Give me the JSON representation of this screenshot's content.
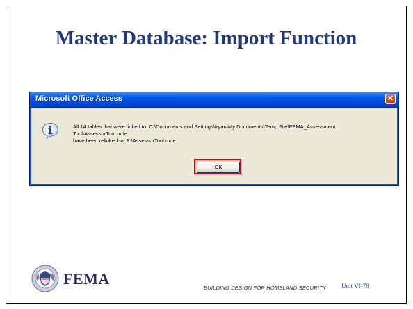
{
  "slide": {
    "title": "Master Database: Import Function",
    "footer": "BUILDING DESIGN FOR HOMELAND SECURITY",
    "unit": "Unit VI-78"
  },
  "logo": {
    "name": "FEMA",
    "seal_icon": "dhs-seal-icon"
  },
  "dialog": {
    "title": "Microsoft Office Access",
    "icon": "info-icon",
    "message_line1": "All 14 tables that were linked to: C:\\Documents and Settings\\tryan\\My Documents\\Temp File\\FEMA_Assessment",
    "message_line2": "Tool\\AssessorTool.mde",
    "message_line3": "have been relinked to: F:\\AssessorTool.mde",
    "ok_label": "OK",
    "close_label": "✕",
    "highlight_color": "#e00000"
  },
  "colors": {
    "title": "#1f3a7a",
    "titlebar": "#0058ee"
  }
}
